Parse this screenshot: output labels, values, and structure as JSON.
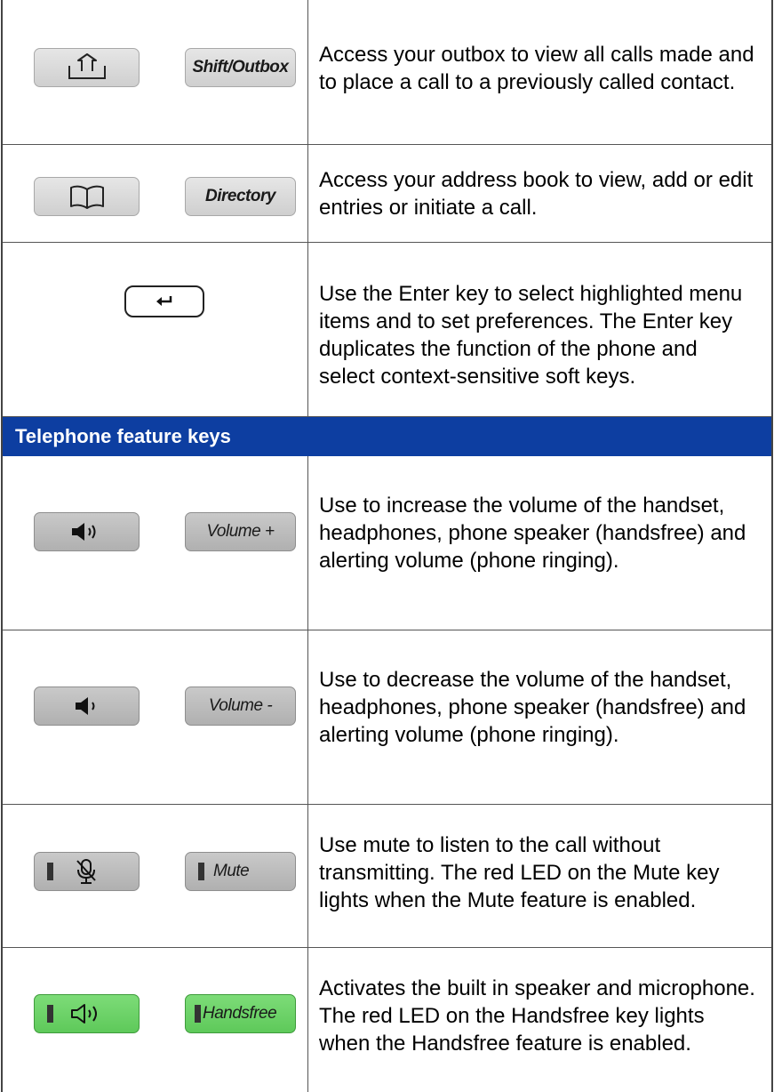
{
  "rows": [
    {
      "key_label": "Shift/Outbox",
      "icon": "outbox-icon",
      "description": "Access your outbox to view all calls made and to place a call to a previously called contact."
    },
    {
      "key_label": "Directory",
      "icon": "book-icon",
      "description": "Access your address book to view, add or edit entries or initiate a call."
    },
    {
      "key_label": "",
      "icon": "enter-icon",
      "description": "Use the Enter key to select highlighted menu items and to set preferences. The Enter key duplicates the function of the phone and select context-sensitive soft keys."
    }
  ],
  "section_header": "Telephone feature keys",
  "feature_rows": [
    {
      "key_label": "Volume +",
      "icon": "volume-up-icon",
      "description": "Use to increase the volume of the handset, headphones, phone speaker (handsfree) and alerting volume (phone ringing)."
    },
    {
      "key_label": "Volume -",
      "icon": "volume-down-icon",
      "description": "Use to decrease the volume of the handset, headphones, phone speaker (handsfree) and alerting volume (phone ringing)."
    },
    {
      "key_label": "Mute",
      "icon": "mute-mic-icon",
      "description": "Use mute to listen to the call without transmitting. The red LED on the Mute key lights when the Mute feature is enabled."
    },
    {
      "key_label": "Handsfree",
      "icon": "speaker-icon",
      "description": "Activates the built in speaker and microphone. The red LED on the Handsfree key lights when the Handsfree feature is enabled.",
      "key_color": "#5ec95a"
    }
  ],
  "colors": {
    "header_bg": "#0d3ea1",
    "header_text": "#ffffff",
    "handsfree_key": "#5ec95a"
  }
}
